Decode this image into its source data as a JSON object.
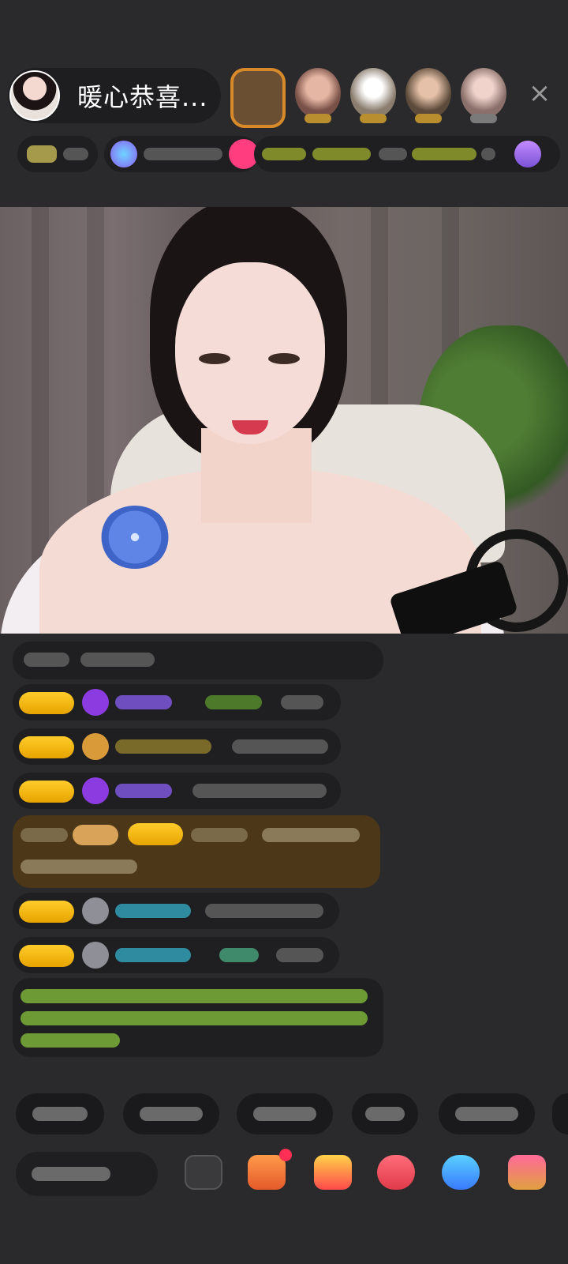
{
  "host": {
    "name": "暖心恭喜...",
    "avatar_icon": "host-avatar"
  },
  "close_icon": "×",
  "colors": {
    "background": "#2a2a2c",
    "pill": "#1f1f21",
    "badge_gold": "#ffcc2b",
    "chat_purple": "#9b7ce0",
    "chat_green": "#8fbf3f",
    "chat_cyan": "#3fb0c9",
    "highlight_brown": "#5a3d1c"
  },
  "icons": [
    "gift-icon",
    "treasure-box-icon",
    "lucky-bag-icon",
    "game-icon",
    "vote-icon",
    "red-envelope-icon"
  ]
}
